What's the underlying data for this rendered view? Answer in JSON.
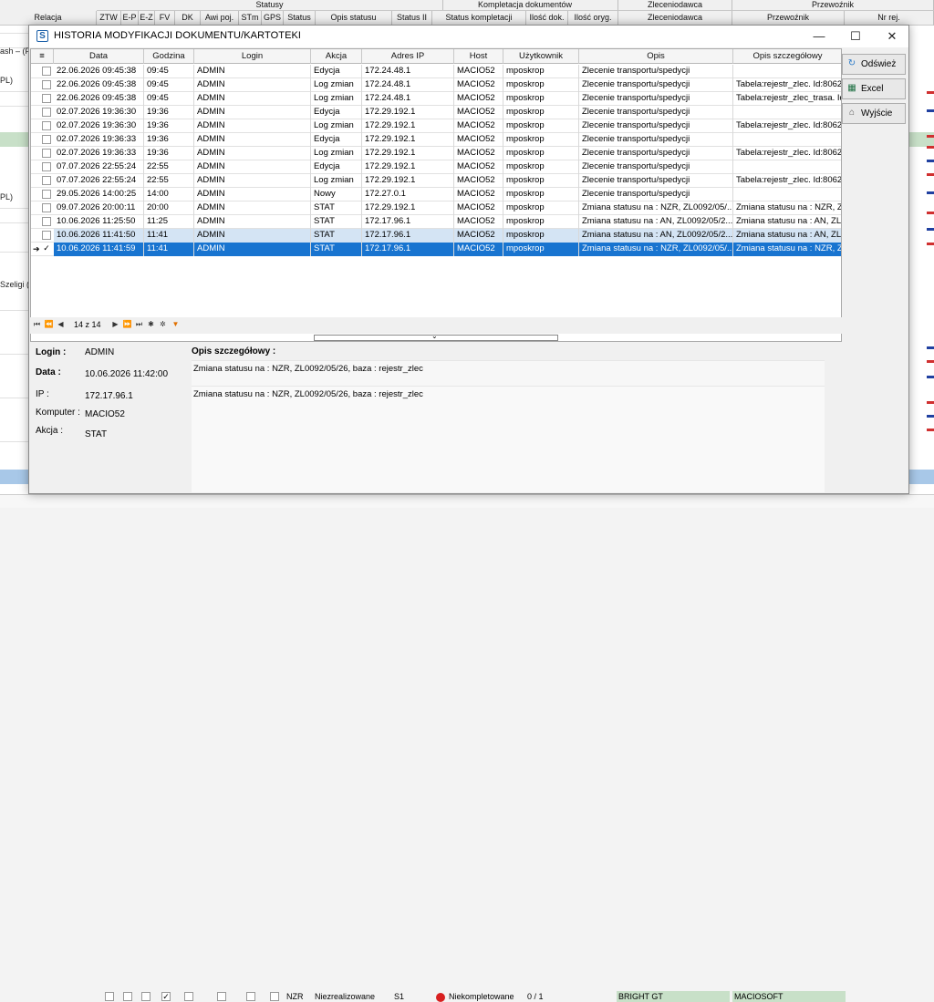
{
  "background": {
    "group_headers": [
      "Statusy",
      "Kompletacja dokumentów",
      "Zleceniodawca",
      "Przewoźnik"
    ],
    "col_headers": [
      "Relacja",
      "ZTW",
      "E-P",
      "E-Z",
      "FV",
      "DK",
      "Awi poj.",
      "STm",
      "GPS",
      "Status",
      "Opis statusu",
      "Status II",
      "Status kompletacji",
      "Ilość dok.",
      "Ilość oryg.",
      "Zleceniodawca",
      "Przewoźnik",
      "Nr rej."
    ],
    "left_texts": [
      "ash – (P",
      "PL)",
      "PL)",
      "Szeligi ("
    ],
    "bottom_row": {
      "status": "NZR",
      "status_desc": "Niezrealizowane",
      "status2": "S1",
      "kompletacja": "Niekompletowane",
      "ilosc": "0 / 1",
      "zleceniodawca": "BRIGHT GT",
      "przewoznik": "MACIOSOFT"
    }
  },
  "dialog": {
    "title": "HISTORIA MODYFIKACJI DOKUMENTU/KARTOTEKI",
    "window_controls": [
      "—",
      "☐",
      "✕"
    ],
    "columns": [
      "Data",
      "Godzina",
      "Login",
      "Akcja",
      "Adres IP",
      "Host",
      "Użytkownik",
      "Opis",
      "Opis szczegółowy"
    ],
    "rows": [
      [
        "22.06.2026 09:45:38",
        "09:45",
        "ADMIN",
        "Edycja",
        "172.24.48.1",
        "MACIO52",
        "mposkrop",
        "Zlecenie transportu/spedycji",
        ""
      ],
      [
        "22.06.2026 09:45:38",
        "09:45",
        "ADMIN",
        "Log zmian",
        "172.24.48.1",
        "MACIO52",
        "mposkrop",
        "Zlecenie transportu/spedycji",
        "Tabela:rejestr_zlec. Id:8062"
      ],
      [
        "22.06.2026 09:45:38",
        "09:45",
        "ADMIN",
        "Log zmian",
        "172.24.48.1",
        "MACIO52",
        "mposkrop",
        "Zlecenie transportu/spedycji",
        "Tabela:rejestr_zlec_trasa. Id"
      ],
      [
        "02.07.2026 19:36:30",
        "19:36",
        "ADMIN",
        "Edycja",
        "172.29.192.1",
        "MACIO52",
        "mposkrop",
        "Zlecenie transportu/spedycji",
        ""
      ],
      [
        "02.07.2026 19:36:30",
        "19:36",
        "ADMIN",
        "Log zmian",
        "172.29.192.1",
        "MACIO52",
        "mposkrop",
        "Zlecenie transportu/spedycji",
        "Tabela:rejestr_zlec. Id:8062"
      ],
      [
        "02.07.2026 19:36:33",
        "19:36",
        "ADMIN",
        "Edycja",
        "172.29.192.1",
        "MACIO52",
        "mposkrop",
        "Zlecenie transportu/spedycji",
        ""
      ],
      [
        "02.07.2026 19:36:33",
        "19:36",
        "ADMIN",
        "Log zmian",
        "172.29.192.1",
        "MACIO52",
        "mposkrop",
        "Zlecenie transportu/spedycji",
        "Tabela:rejestr_zlec. Id:8062"
      ],
      [
        "07.07.2026 22:55:24",
        "22:55",
        "ADMIN",
        "Edycja",
        "172.29.192.1",
        "MACIO52",
        "mposkrop",
        "Zlecenie transportu/spedycji",
        ""
      ],
      [
        "07.07.2026 22:55:24",
        "22:55",
        "ADMIN",
        "Log zmian",
        "172.29.192.1",
        "MACIO52",
        "mposkrop",
        "Zlecenie transportu/spedycji",
        "Tabela:rejestr_zlec. Id:8062"
      ],
      [
        "29.05.2026 14:00:25",
        "14:00",
        "ADMIN",
        "Nowy",
        "172.27.0.1",
        "MACIO52",
        "mposkrop",
        "Zlecenie transportu/spedycji",
        ""
      ],
      [
        "09.07.2026 20:00:11",
        "20:00",
        "ADMIN",
        "STAT",
        "172.29.192.1",
        "MACIO52",
        "mposkrop",
        "Zmiana statusu na : NZR, ZL0092/05/...",
        "Zmiana statusu na : NZR, ZL"
      ],
      [
        "10.06.2026 11:25:50",
        "11:25",
        "ADMIN",
        "STAT",
        "172.17.96.1",
        "MACIO52",
        "mposkrop",
        "Zmiana statusu na : AN, ZL0092/05/2...",
        "Zmiana statusu na : AN, ZL0"
      ],
      [
        "10.06.2026 11:41:50",
        "11:41",
        "ADMIN",
        "STAT",
        "172.17.96.1",
        "MACIO52",
        "mposkrop",
        "Zmiana statusu na : AN, ZL0092/05/2...",
        "Zmiana statusu na : AN, ZL0"
      ],
      [
        "10.06.2026 11:41:59",
        "11:41",
        "ADMIN",
        "STAT",
        "172.17.96.1",
        "MACIO52",
        "mposkrop",
        "Zmiana statusu na : NZR, ZL0092/05/...",
        "Zmiana statusu na : NZR, ZL"
      ]
    ],
    "selected_row": 13,
    "navigator": {
      "position": "14 z 14"
    },
    "buttons": {
      "refresh": "Odśwież",
      "excel": "Excel",
      "exit": "Wyjście"
    },
    "details": {
      "login_label": "Login :",
      "login": "ADMIN",
      "data_label": "Data :",
      "data": "10.06.2026 11:42:00",
      "ip_label": "IP :",
      "ip": "172.17.96.1",
      "komputer_label": "Komputer :",
      "komputer": "MACIO52",
      "akcja_label": "Akcja :",
      "akcja": "STAT",
      "opis_label": "Opis szczegółowy :",
      "opis_lines": [
        "Zmiana statusu na : NZR, ZL0092/05/26, baza : rejestr_zlec",
        "Zmiana statusu na : NZR, ZL0092/05/26, baza : rejestr_zlec"
      ]
    },
    "colors": {
      "selection": "#1874d0",
      "row_highlight": "#d4e4f4"
    }
  }
}
